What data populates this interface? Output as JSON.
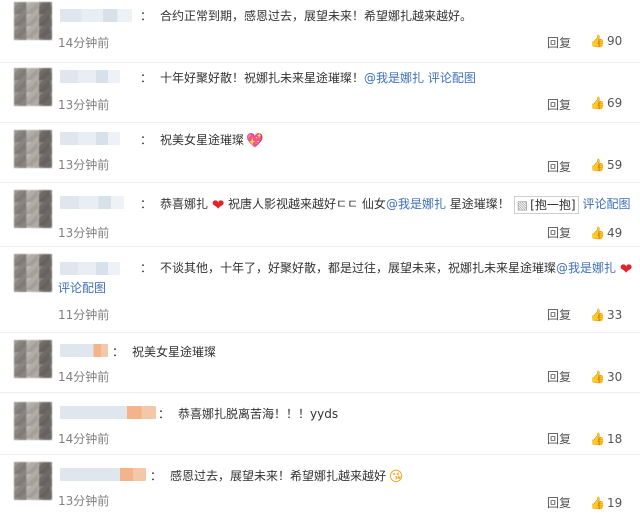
{
  "comments": [
    {
      "text": "合约正常到期，感恩过去，展望未来！希望娜扎越来越好。",
      "time": "14分钟前",
      "reply": "回复",
      "likes": "90"
    },
    {
      "text": "十年好聚好散！祝娜扎未来星途璀璨！",
      "mention": "@我是娜扎",
      "link": "评论配图",
      "time": "13分钟前",
      "reply": "回复",
      "likes": "69"
    },
    {
      "text": "祝美女星途璀璨",
      "time": "13分钟前",
      "reply": "回复",
      "likes": "59"
    },
    {
      "text1": "恭喜娜扎",
      "text2": "祝唐人影视越来越好ㄷㄷ 仙女",
      "mention": "@我是娜扎",
      "text3": "星途璀璨！",
      "image_label": "[抱一抱]",
      "link": "评论配图",
      "time": "13分钟前",
      "reply": "回复",
      "likes": "49"
    },
    {
      "text": "不谈其他，十年了，好聚好散，都是过往，展望未来，祝娜扎未来星途璀璨",
      "mention": "@我是娜扎",
      "link": "评论配图",
      "time": "11分钟前",
      "reply": "回复",
      "likes": "33"
    },
    {
      "text": "祝美女星途璀璨",
      "time": "14分钟前",
      "reply": "回复",
      "likes": "30"
    },
    {
      "text": "恭喜娜扎脱离苦海！！！yyds",
      "time": "14分钟前",
      "reply": "回复",
      "likes": "18"
    },
    {
      "text": "感恩过去，展望未来！希望娜扎越来越好",
      "time": "13分钟前",
      "reply": "回复",
      "likes": "19"
    }
  ],
  "icons": {
    "like": "thumbs-up-icon",
    "heart": "red-heart-icon",
    "pink_heart": "pink-heart-icon",
    "face": "blushing-face-icon"
  },
  "colors": {
    "link": "#3e6fb8",
    "meta": "#808080",
    "heart": "#e0242a"
  }
}
